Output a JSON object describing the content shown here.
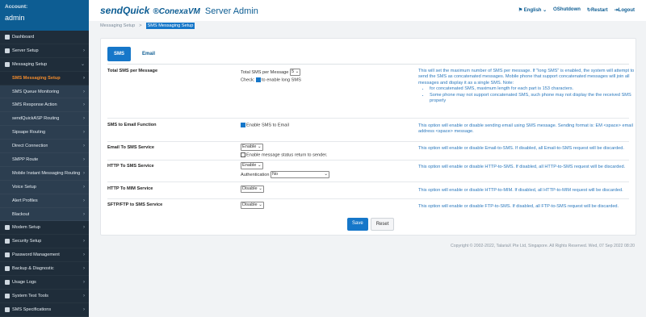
{
  "sidebar": {
    "account_label": "Account:",
    "account_user": "admin",
    "items": [
      {
        "label": "Dashboard",
        "icon": "dashboard-icon",
        "chevron": false
      },
      {
        "label": "Server Setup",
        "icon": "server-icon",
        "chevron": true
      },
      {
        "label": "Messaging Setup",
        "icon": "messaging-icon",
        "chevron": true
      }
    ],
    "sub_items": [
      {
        "label": "SMS Messaging Setup",
        "active": true
      },
      {
        "label": "SMS Queue Monitoring"
      },
      {
        "label": "SMS Response Action"
      },
      {
        "label": "sendQuickASP Routing"
      },
      {
        "label": "Sipsape Routing"
      },
      {
        "label": "Direct Connection"
      },
      {
        "label": "SMPP Route"
      },
      {
        "label": "Mobile Instant Messaging Routing"
      },
      {
        "label": "Voice Setup"
      },
      {
        "label": "Alert Profiles"
      },
      {
        "label": "Blackout"
      }
    ],
    "bottom_items": [
      {
        "label": "Modem Setup",
        "icon": "modem-icon"
      },
      {
        "label": "Security Setup",
        "icon": "lock-icon"
      },
      {
        "label": "Password Management",
        "icon": "key-icon"
      },
      {
        "label": "Backup & Diagnostic",
        "icon": "heart-icon"
      },
      {
        "label": "Usage Logs",
        "icon": "chart-icon"
      },
      {
        "label": "System Test Tools",
        "icon": "wrench-icon"
      },
      {
        "label": "SMS Specifications",
        "icon": "file-icon"
      }
    ]
  },
  "header": {
    "brand_send": "sendQuick",
    "brand_conexa": "®ConexaVM",
    "title": "Server Admin",
    "language": "English",
    "shutdown": "Shutdown",
    "restart": "Restart",
    "logout": "Logout"
  },
  "breadcrumb": {
    "parent": "Messaging Setup",
    "sep": ">",
    "current": "SMS Messaging Setup"
  },
  "tabs": [
    {
      "label": "SMS",
      "active": true
    },
    {
      "label": "Email",
      "active": false
    }
  ],
  "form": {
    "total_sms": {
      "label": "Total SMS per Message",
      "field_label": "Total SMS per Message",
      "value": "5",
      "check_prefix": "Check:",
      "check_label": "to enable long SMS",
      "desc": "This will set the maximum number of SMS per message. If \"long SMS\" is enabled, the system will attempt to send the SMS as concatenated messages. Mobile phone that support concatenated messages will join all messages and display it as a single SMS. Note:",
      "bullets": [
        "for concatenated SMS, maximum length for each part is 153 characters.",
        "Some phone may not support concatenated SMS, such phone may not display the the received SMS properly"
      ]
    },
    "sms_to_email_fn": {
      "label": "SMS to Email Function",
      "check_label": "Enable SMS to Email",
      "desc": "This option will enable or disable sending email using SMS message. Sending format is: EM <space> email address <space> message."
    },
    "email_to_sms": {
      "label": "Email To SMS Service",
      "value": "Enable",
      "check_label": "Enable message status return to sender.",
      "desc": "This option will enable or disable Email-to-SMS. If disabled, all Email-to-SMS request will be discarded."
    },
    "http_to_sms": {
      "label": "HTTP To SMS Service",
      "value": "Enable",
      "auth_label": "Authentication",
      "auth_value": "No",
      "desc": "This option will enable or disable HTTP-to-SMS. If disabled, all HTTP-to-SMS request will be discarded."
    },
    "http_to_mim": {
      "label": "HTTP To MIM Service",
      "value": "Disable",
      "desc": "This option will enable or disable HTTP-to-MIM. If disabled, all HTTP-to-MIM request will be discarded."
    },
    "sftp_to_sms": {
      "label": "SFTP/FTP to SMS Service",
      "value": "Disable",
      "desc": "This option will enable or disable FTP-to-SMS. If disabled, all FTP-to-SMS request will be discarded."
    },
    "save_label": "Save",
    "reset_label": "Reset"
  },
  "footer": "Copyright © 2002-2022, TalariaX Pte Ltd, Singapore. All Rights Reserved. Wed, 07 Sep 2022 08:20",
  "colors": {
    "accent": "#1677c9",
    "sidebar": "#1f2d3a",
    "active_menu": "#f08a2c"
  }
}
